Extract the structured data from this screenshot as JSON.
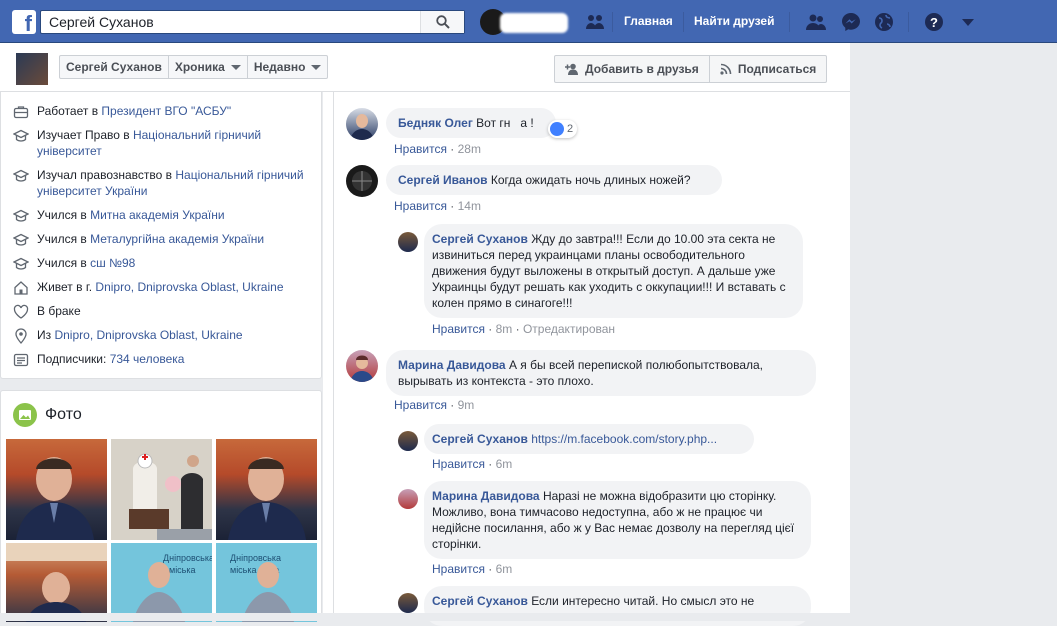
{
  "topbar": {
    "search_value": "Сергей Суханов",
    "nav": {
      "home": "Главная",
      "find_friends": "Найти друзей"
    }
  },
  "profile_bar": {
    "name": "Сергей Суханов",
    "timeline": "Хроника",
    "recent": "Недавно",
    "add_friend": "Добавить в друзья",
    "follow": "Подписаться"
  },
  "intro": {
    "rows": [
      {
        "icon": "briefcase-icon",
        "prefix": "Работает в ",
        "link": "Президент ВГО \"АСБУ\"",
        "suffix": ""
      },
      {
        "icon": "graduation-cap-icon",
        "prefix": "Изучает Право в ",
        "link": "Національний гірничий університет",
        "suffix": ""
      },
      {
        "icon": "graduation-cap-icon",
        "prefix": "Изучал правознавство в ",
        "link": "Національний гірничий університет України",
        "suffix": ""
      },
      {
        "icon": "graduation-cap-icon",
        "prefix": "Учился в ",
        "link": "Митна академія України",
        "suffix": ""
      },
      {
        "icon": "graduation-cap-icon",
        "prefix": "Учился в ",
        "link": "Металургійна академія України",
        "suffix": ""
      },
      {
        "icon": "graduation-cap-icon",
        "prefix": "Учился в ",
        "link": "сш №98",
        "suffix": ""
      },
      {
        "icon": "home-icon",
        "prefix": "Живет в г. ",
        "link": "Dnipro, Dniprovska Oblast, Ukraine",
        "suffix": ""
      },
      {
        "icon": "heart-icon",
        "prefix": "В браке",
        "link": "",
        "suffix": ""
      },
      {
        "icon": "location-pin-icon",
        "prefix": "Из ",
        "link": "Dnipro, Dniprovska Oblast, Ukraine",
        "suffix": ""
      },
      {
        "icon": "followers-icon",
        "prefix": "Подписчики: ",
        "link": "734 человека",
        "suffix": ""
      }
    ]
  },
  "photos": {
    "title": "Фото"
  },
  "comments": [
    {
      "name": "Бедняк Олег",
      "text": "Вот гн",
      "text_tail": "а !",
      "like": "Нравится",
      "time": "28m",
      "reaction_count": "2"
    },
    {
      "name": "Сергей Иванов",
      "text": "Когда ожидать ночь длиных ножей?",
      "like": "Нравится",
      "time": "14m"
    },
    {
      "name": "Сергей Суханов",
      "text": "Жду до завтра!!! Если до 10.00 эта секта не извиниться перед украинцами планы освободительного движения будут выложены в открытый доступ. А дальше уже Украинцы будут решать как уходить с оккупации!!! И вставать с колен прямо в синагоге!!!",
      "like": "Нравится",
      "time": "8m",
      "edited": "Отредактирован"
    },
    {
      "name": "Марина Давидова",
      "text": "А я бы всей перепиской полюбопытствовала, вырывать из контекста - это плохо.",
      "like": "Нравится",
      "time": "9m"
    },
    {
      "name": "Сергей Суханов",
      "text": "https://m.facebook.com/story.php...",
      "like": "Нравится",
      "time": "6m"
    },
    {
      "name": "Марина Давидова",
      "text": "Наразі не можна відобразити цю сторінку. Можливо, вона тимчасово недоступна, або ж не працює чи недійсне посилання, або ж у Вас немає дозволу на перегляд цієї сторінки.",
      "like": "Нравится",
      "time": "6m"
    },
    {
      "name": "Сергей Суханов",
      "text": "Если интересно читай. Но смысл это не"
    }
  ],
  "colors": {
    "brand": "#4267b2",
    "link": "#385898",
    "bubble": "#f2f3f5"
  }
}
